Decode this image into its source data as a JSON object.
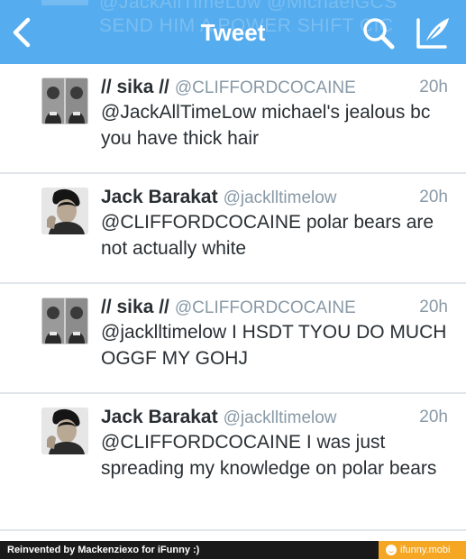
{
  "nav": {
    "title": "Tweet",
    "ghost_line_1": "@JackAllTimeLow @MichaelGCS",
    "ghost_line_2": "SEND HIM A POWER SHIFT CIC"
  },
  "colors": {
    "nav_background": "#55acee",
    "name_text": "#292f33",
    "meta_text": "#8899a6",
    "divider": "#e1e6ea",
    "footer_background": "#1a1a1a",
    "footer_badge": "#f5a623"
  },
  "tweets": [
    {
      "name": "// sika //",
      "handle": "@CLIFFORDCOCAINE",
      "time": "20h",
      "text": "@JackAllTimeLow michael's jealous bc you have thick hair",
      "avatar_icon": "avatar-two-photos"
    },
    {
      "name": "Jack Barakat",
      "handle": "@jacklltimelow",
      "time": "20h",
      "text": "@CLIFFORDCOCAINE polar bears are not actually white",
      "avatar_icon": "avatar-portrait"
    },
    {
      "name": "// sika //",
      "handle": "@CLIFFORDCOCAINE",
      "time": "20h",
      "text": "@jacklltimelow I HSDT TYOU DO MUCH OGGF MY GOHJ",
      "avatar_icon": "avatar-two-photos"
    },
    {
      "name": "Jack Barakat",
      "handle": "@jacklltimelow",
      "time": "20h",
      "text": "@CLIFFORDCOCAINE I was just spreading my knowledge on polar bears",
      "avatar_icon": "avatar-portrait"
    }
  ],
  "footer": {
    "credit": "Reinvented by Mackenziexo for iFunny :)",
    "brand": "ifunny.mobi"
  }
}
